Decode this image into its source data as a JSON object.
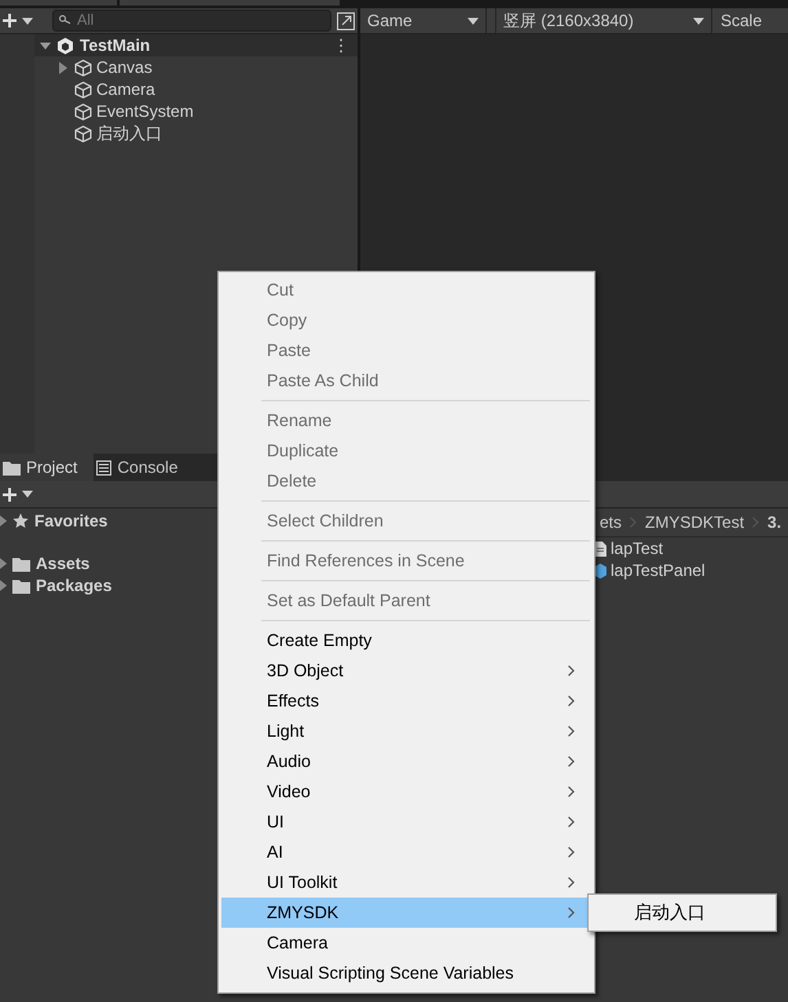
{
  "hierarchy": {
    "search": {
      "placeholder": "All"
    },
    "scene": {
      "title": "TestMain",
      "more": "⋮"
    },
    "objects": [
      {
        "label": "Canvas",
        "expandable": true
      },
      {
        "label": "Camera",
        "expandable": false
      },
      {
        "label": "EventSystem",
        "expandable": false
      },
      {
        "label": "启动入口",
        "expandable": false
      }
    ]
  },
  "game_toolbar": {
    "display": "Game",
    "resolution": "竖屏 (2160x3840)",
    "scale_label": "Scale"
  },
  "project": {
    "tabs": [
      {
        "label": "Project",
        "selected": true,
        "kind": "folder"
      },
      {
        "label": "Console",
        "selected": false,
        "kind": "console"
      }
    ],
    "tree": [
      {
        "label": "Favorites",
        "kind": "favorites"
      },
      {
        "label": "Assets",
        "kind": "folder"
      },
      {
        "label": "Packages",
        "kind": "folder"
      }
    ],
    "breadcrumb": [
      "ets",
      "ZMYSDKTest",
      "3."
    ],
    "files": [
      {
        "label": "lapTest",
        "kind": "script"
      },
      {
        "label": "lapTestPanel",
        "kind": "prefab"
      }
    ]
  },
  "context_menu": {
    "groups": [
      [
        {
          "label": "Cut",
          "disabled": true,
          "submenu": false,
          "selected": false
        },
        {
          "label": "Copy",
          "disabled": true,
          "submenu": false,
          "selected": false
        },
        {
          "label": "Paste",
          "disabled": true,
          "submenu": false,
          "selected": false
        },
        {
          "label": "Paste As Child",
          "disabled": true,
          "submenu": false,
          "selected": false
        }
      ],
      [
        {
          "label": "Rename",
          "disabled": true,
          "submenu": false,
          "selected": false
        },
        {
          "label": "Duplicate",
          "disabled": true,
          "submenu": false,
          "selected": false
        },
        {
          "label": "Delete",
          "disabled": true,
          "submenu": false,
          "selected": false
        }
      ],
      [
        {
          "label": "Select Children",
          "disabled": true,
          "submenu": false,
          "selected": false
        }
      ],
      [
        {
          "label": "Find References in Scene",
          "disabled": true,
          "submenu": false,
          "selected": false
        }
      ],
      [
        {
          "label": "Set as Default Parent",
          "disabled": true,
          "submenu": false,
          "selected": false
        }
      ],
      [
        {
          "label": "Create Empty",
          "disabled": false,
          "submenu": false,
          "selected": false
        },
        {
          "label": "3D Object",
          "disabled": false,
          "submenu": true,
          "selected": false
        },
        {
          "label": "Effects",
          "disabled": false,
          "submenu": true,
          "selected": false
        },
        {
          "label": "Light",
          "disabled": false,
          "submenu": true,
          "selected": false
        },
        {
          "label": "Audio",
          "disabled": false,
          "submenu": true,
          "selected": false
        },
        {
          "label": "Video",
          "disabled": false,
          "submenu": true,
          "selected": false
        },
        {
          "label": "UI",
          "disabled": false,
          "submenu": true,
          "selected": false
        },
        {
          "label": "AI",
          "disabled": false,
          "submenu": true,
          "selected": false
        },
        {
          "label": "UI Toolkit",
          "disabled": false,
          "submenu": true,
          "selected": false
        },
        {
          "label": "ZMYSDK",
          "disabled": false,
          "submenu": true,
          "selected": true
        },
        {
          "label": "Camera",
          "disabled": false,
          "submenu": false,
          "selected": false
        },
        {
          "label": "Visual Scripting Scene Variables",
          "disabled": false,
          "submenu": false,
          "selected": false
        }
      ]
    ],
    "submenu": {
      "items": [
        {
          "label": "启动入口"
        }
      ]
    }
  }
}
